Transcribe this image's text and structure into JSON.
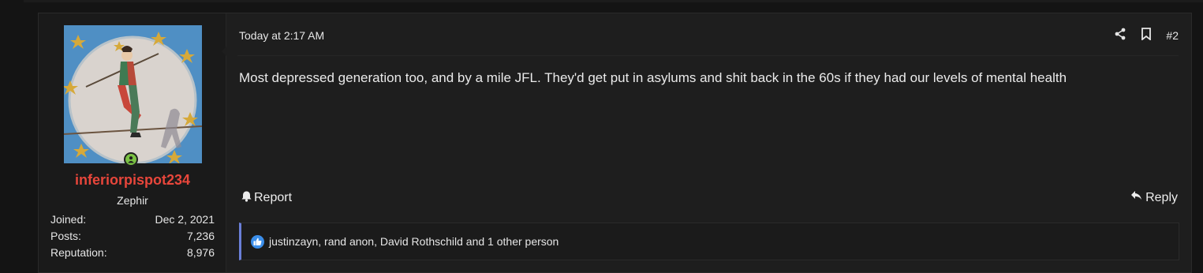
{
  "post": {
    "timestamp": "Today at 2:17 AM",
    "post_number": "#2",
    "content": "Most depressed generation too, and by a mile JFL. They'd get put in asylums and shit back in the 60s if they had our levels of mental health",
    "actions": {
      "report_label": "Report",
      "reply_label": "Reply"
    },
    "reactions_text": "justinzayn, rand anon, David Rothschild and 1 other person"
  },
  "user": {
    "username": "inferiorpispot234",
    "title": "Zephir",
    "stats": [
      {
        "label": "Joined:",
        "value": "Dec 2, 2021"
      },
      {
        "label": "Posts:",
        "value": "7,236"
      },
      {
        "label": "Reputation:",
        "value": "8,976"
      }
    ]
  },
  "colors": {
    "username": "#e8463b",
    "online": "#7ac143",
    "reaction_accent": "#6a7fd8",
    "like": "#3b8eea"
  },
  "icons": {
    "share": "share-icon",
    "bookmark": "bookmark-icon",
    "report": "bell-icon",
    "reply": "reply-arrow-icon",
    "reaction": "thumbs-up-icon",
    "online": "online-status-icon"
  }
}
